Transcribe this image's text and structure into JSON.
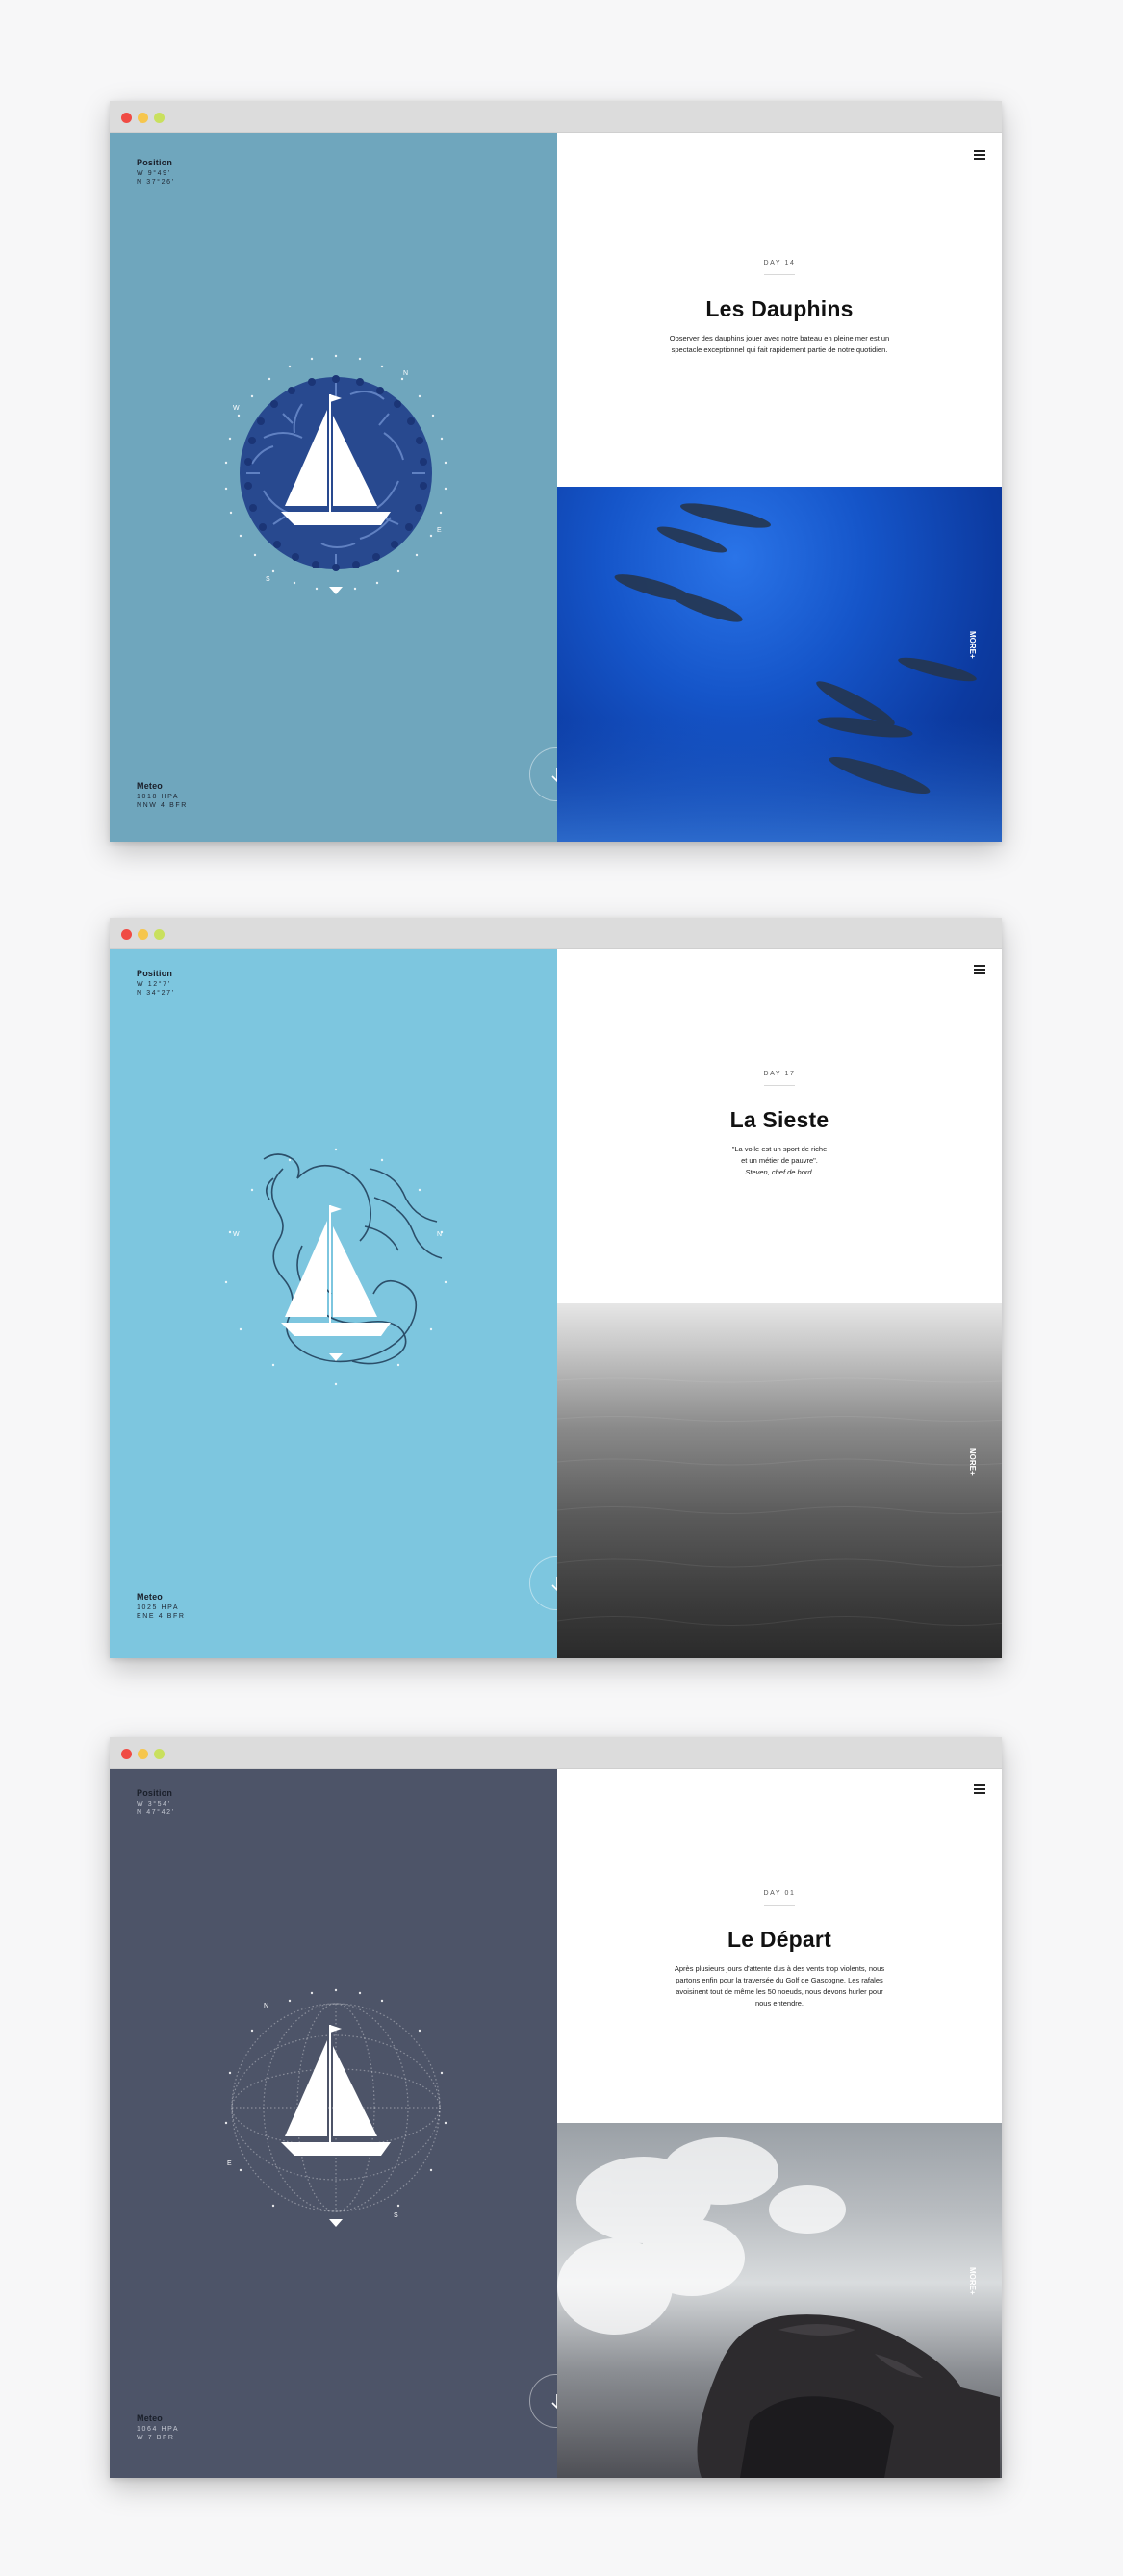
{
  "windows": [
    {
      "left_bg": "#6fa6bd",
      "emblem": "dolphin-sphere-sailboat",
      "position_label": "Position",
      "position_lines": [
        "W 9°49'",
        "N 37°26'"
      ],
      "meteo_label": "Meteo",
      "meteo_lines": [
        "1018 HPA",
        "NNW 4 BFR"
      ],
      "day": "DAY 14",
      "title": "Les Dauphins",
      "text_lines": [
        "Observer des dauphins jouer avec notre bateau en pleine mer est un",
        "spectacle exceptionnel qui fait rapidement partie de notre quotidien."
      ],
      "more": "MORE+",
      "photo": "dolphins-underwater"
    },
    {
      "left_bg": "#7dc6df",
      "emblem": "mermaid-engraving-sailboat",
      "position_label": "Position",
      "position_lines": [
        "W 12°7'",
        "N 34°27'"
      ],
      "meteo_label": "Meteo",
      "meteo_lines": [
        "1025 HPA",
        "ENE 4 BFR"
      ],
      "day": "DAY 17",
      "title": "La Sieste",
      "text_lines": [
        "\"La voile est un sport de riche",
        "et un métier de pauvre\".",
        "Steven, chef de bord."
      ],
      "more": "MORE+",
      "photo": "calm-grey-sea"
    },
    {
      "left_bg": "#4d5468",
      "emblem": "dotted-globe-sailboat",
      "position_label": "Position",
      "position_lines": [
        "W 3°54'",
        "N 47°42'"
      ],
      "meteo_label": "Meteo",
      "meteo_lines": [
        "1064 HPA",
        "W 7 BFR"
      ],
      "day": "DAY 01",
      "title": "Le Départ",
      "text_lines": [
        "Après plusieurs jours d'attente dus à des vents trop violents, nous",
        "partons enfin pour la traversée du Golf de Gascogne. Les rafales",
        "avoisinent tout de même les 50 noeuds, nous devons hurler pour",
        "nous entendre."
      ],
      "more": "MORE+",
      "photo": "waves-crashing-rocks"
    }
  ]
}
